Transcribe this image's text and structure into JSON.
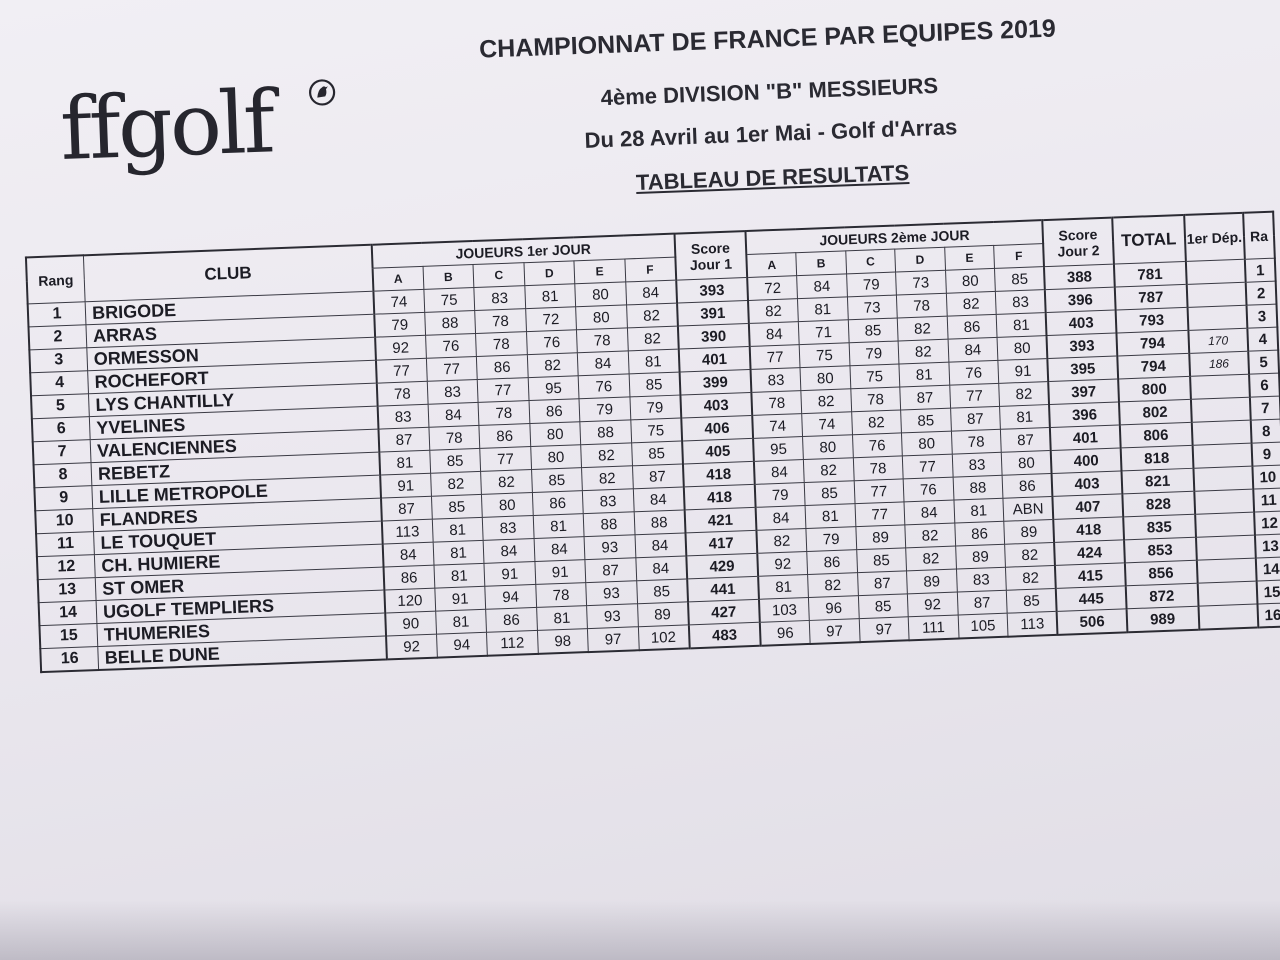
{
  "logo": {
    "text": "ffgolf",
    "mark": "®"
  },
  "header": {
    "title": "CHAMPIONNAT DE FRANCE PAR EQUIPES 2019",
    "division": "4ème DIVISION \"B\" MESSIEURS",
    "dates": "Du  28 Avril au  1er Mai  - Golf d'Arras",
    "table_title": "TABLEAU DE RESULTATS"
  },
  "table": {
    "h_rang": "Rang",
    "h_club": "CLUB",
    "h_day1": "JOUEURS 1er JOUR",
    "h_score1": "Score Jour 1",
    "h_day2": "JOUEURS 2ème JOUR",
    "h_score2": "Score Jour 2",
    "h_total": "TOTAL",
    "h_dep": "1er Dép.",
    "h_rank2": "Ra",
    "players": [
      "A",
      "B",
      "C",
      "D",
      "E",
      "F"
    ],
    "rows": [
      {
        "rank": "1",
        "club": "BRIGODE",
        "d1": [
          "74",
          "75",
          "83",
          "81",
          "80",
          "84"
        ],
        "s1": "393",
        "d2": [
          "72",
          "84",
          "79",
          "73",
          "80",
          "85"
        ],
        "s2": "388",
        "total": "781",
        "dep": "",
        "r2": "1"
      },
      {
        "rank": "2",
        "club": "ARRAS",
        "d1": [
          "79",
          "88",
          "78",
          "72",
          "80",
          "82"
        ],
        "s1": "391",
        "d2": [
          "82",
          "81",
          "73",
          "78",
          "82",
          "83"
        ],
        "s2": "396",
        "total": "787",
        "dep": "",
        "r2": "2"
      },
      {
        "rank": "3",
        "club": "ORMESSON",
        "d1": [
          "92",
          "76",
          "78",
          "76",
          "78",
          "82"
        ],
        "s1": "390",
        "d2": [
          "84",
          "71",
          "85",
          "82",
          "86",
          "81"
        ],
        "s2": "403",
        "total": "793",
        "dep": "",
        "r2": "3"
      },
      {
        "rank": "4",
        "club": "ROCHEFORT",
        "d1": [
          "77",
          "77",
          "86",
          "82",
          "84",
          "81"
        ],
        "s1": "401",
        "d2": [
          "77",
          "75",
          "79",
          "82",
          "84",
          "80"
        ],
        "s2": "393",
        "total": "794",
        "dep": "170",
        "r2": "4"
      },
      {
        "rank": "5",
        "club": "LYS CHANTILLY",
        "d1": [
          "78",
          "83",
          "77",
          "95",
          "76",
          "85"
        ],
        "s1": "399",
        "d2": [
          "83",
          "80",
          "75",
          "81",
          "76",
          "91"
        ],
        "s2": "395",
        "total": "794",
        "dep": "186",
        "r2": "5"
      },
      {
        "rank": "6",
        "club": "YVELINES",
        "d1": [
          "83",
          "84",
          "78",
          "86",
          "79",
          "79"
        ],
        "s1": "403",
        "d2": [
          "78",
          "82",
          "78",
          "87",
          "77",
          "82"
        ],
        "s2": "397",
        "total": "800",
        "dep": "",
        "r2": "6"
      },
      {
        "rank": "7",
        "club": "VALENCIENNES",
        "d1": [
          "87",
          "78",
          "86",
          "80",
          "88",
          "75"
        ],
        "s1": "406",
        "d2": [
          "74",
          "74",
          "82",
          "85",
          "87",
          "81"
        ],
        "s2": "396",
        "total": "802",
        "dep": "",
        "r2": "7"
      },
      {
        "rank": "8",
        "club": "REBETZ",
        "d1": [
          "81",
          "85",
          "77",
          "80",
          "82",
          "85"
        ],
        "s1": "405",
        "d2": [
          "95",
          "80",
          "76",
          "80",
          "78",
          "87"
        ],
        "s2": "401",
        "total": "806",
        "dep": "",
        "r2": "8"
      },
      {
        "rank": "9",
        "club": "LILLE METROPOLE",
        "d1": [
          "91",
          "82",
          "82",
          "85",
          "82",
          "87"
        ],
        "s1": "418",
        "d2": [
          "84",
          "82",
          "78",
          "77",
          "83",
          "80"
        ],
        "s2": "400",
        "total": "818",
        "dep": "",
        "r2": "9"
      },
      {
        "rank": "10",
        "club": "FLANDRES",
        "d1": [
          "87",
          "85",
          "80",
          "86",
          "83",
          "84"
        ],
        "s1": "418",
        "d2": [
          "79",
          "85",
          "77",
          "76",
          "88",
          "86"
        ],
        "s2": "403",
        "total": "821",
        "dep": "",
        "r2": "10"
      },
      {
        "rank": "11",
        "club": "LE TOUQUET",
        "d1": [
          "113",
          "81",
          "83",
          "81",
          "88",
          "88"
        ],
        "s1": "421",
        "d2": [
          "84",
          "81",
          "77",
          "84",
          "81",
          "ABN"
        ],
        "s2": "407",
        "total": "828",
        "dep": "",
        "r2": "11"
      },
      {
        "rank": "12",
        "club": "CH. HUMIERE",
        "d1": [
          "84",
          "81",
          "84",
          "84",
          "93",
          "84"
        ],
        "s1": "417",
        "d2": [
          "82",
          "79",
          "89",
          "82",
          "86",
          "89"
        ],
        "s2": "418",
        "total": "835",
        "dep": "",
        "r2": "12"
      },
      {
        "rank": "13",
        "club": "ST OMER",
        "d1": [
          "86",
          "81",
          "91",
          "91",
          "87",
          "84"
        ],
        "s1": "429",
        "d2": [
          "92",
          "86",
          "85",
          "82",
          "89",
          "82"
        ],
        "s2": "424",
        "total": "853",
        "dep": "",
        "r2": "13"
      },
      {
        "rank": "14",
        "club": "UGOLF TEMPLIERS",
        "d1": [
          "120",
          "91",
          "94",
          "78",
          "93",
          "85"
        ],
        "s1": "441",
        "d2": [
          "81",
          "82",
          "87",
          "89",
          "83",
          "82"
        ],
        "s2": "415",
        "total": "856",
        "dep": "",
        "r2": "14"
      },
      {
        "rank": "15",
        "club": "THUMERIES",
        "d1": [
          "90",
          "81",
          "86",
          "81",
          "93",
          "89"
        ],
        "s1": "427",
        "d2": [
          "103",
          "96",
          "85",
          "92",
          "87",
          "85"
        ],
        "s2": "445",
        "total": "872",
        "dep": "",
        "r2": "15"
      },
      {
        "rank": "16",
        "club": "BELLE DUNE",
        "d1": [
          "92",
          "94",
          "112",
          "98",
          "97",
          "102"
        ],
        "s1": "483",
        "d2": [
          "96",
          "97",
          "97",
          "111",
          "105",
          "113"
        ],
        "s2": "506",
        "total": "989",
        "dep": "",
        "r2": "16"
      }
    ]
  }
}
